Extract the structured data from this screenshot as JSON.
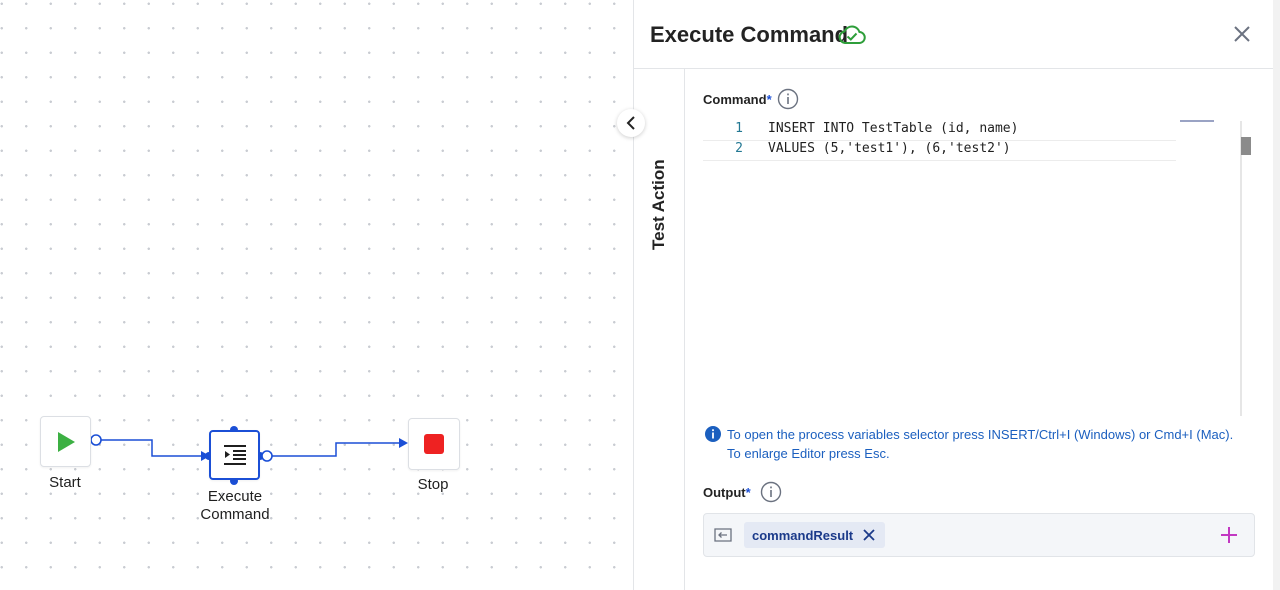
{
  "flow": {
    "start_label": "Start",
    "exec_label_line1": "Execute",
    "exec_label_line2": "Command",
    "stop_label": "Stop"
  },
  "panel": {
    "title": "Execute Command",
    "side_tab": "Test Action",
    "command": {
      "label": "Command",
      "required_mark": "*",
      "lines": [
        {
          "number": "1",
          "code": "INSERT INTO TestTable (id, name)"
        },
        {
          "number": "2",
          "code": "VALUES (5,'test1'), (6,'test2')"
        }
      ]
    },
    "hint": {
      "line1": "To open the process variables selector press INSERT/Ctrl+I (Windows) or Cmd+I (Mac).",
      "line2": "To enlarge Editor press Esc."
    },
    "output": {
      "label": "Output",
      "required_mark": "*",
      "variable": "commandResult"
    }
  },
  "colors": {
    "accent": "#1b4fd6",
    "start_green": "#3cb043",
    "stop_red": "#ee2222",
    "saved_green": "#2e9e3a",
    "add_magenta": "#c238c2",
    "hint_blue": "#1b5fbf"
  },
  "icons": [
    "play-icon",
    "stop-icon",
    "execute-command-icon",
    "cloud-check-icon",
    "close-icon",
    "chevron-left-icon",
    "info-icon",
    "variable-icon",
    "remove-icon",
    "plus-icon"
  ]
}
